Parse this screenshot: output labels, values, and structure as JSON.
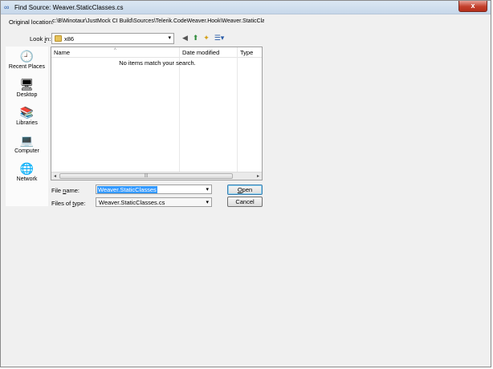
{
  "window": {
    "title": "Find Source: Weaver.StaticClasses.cs",
    "close_glyph": "x"
  },
  "original_location": {
    "label": "Original location:",
    "value": "c:\\B\\Minotaur\\JustMock CI Build\\Sources\\Telerik.CodeWeaver.Hook\\Weaver.StaticClasses.c"
  },
  "look_in": {
    "label_prefix": "Look ",
    "label_accel": "i",
    "label_suffix": "n:",
    "value": "x86"
  },
  "toolbar": {
    "back_glyph": "◀",
    "up_glyph": "⬆",
    "new_folder_glyph": "✦",
    "view_glyph": "☰▾"
  },
  "sidebar": {
    "items": [
      {
        "label": "Recent Places",
        "icon": "recent-places-icon",
        "glyph": "🕘"
      },
      {
        "label": "Desktop",
        "icon": "desktop-icon",
        "glyph": "🖥"
      },
      {
        "label": "Libraries",
        "icon": "libraries-icon",
        "glyph": "📚"
      },
      {
        "label": "Computer",
        "icon": "computer-icon",
        "glyph": "💻"
      },
      {
        "label": "Network",
        "icon": "network-icon",
        "glyph": "🌐"
      }
    ]
  },
  "file_list": {
    "columns": [
      "Name",
      "Date modified",
      "Type"
    ],
    "empty_message": "No items match your search.",
    "scroll_left": "◂",
    "scroll_right": "▸",
    "thumb_grip": "|||"
  },
  "file_name": {
    "label_prefix": "File ",
    "label_accel": "n",
    "label_suffix": "ame:",
    "value": "Weaver.StaticClasses"
  },
  "files_of_type": {
    "label_prefix": "Files of ",
    "label_accel": "t",
    "label_suffix": "ype:",
    "value": "Weaver.StaticClasses.cs"
  },
  "buttons": {
    "open_accel": "O",
    "open_rest": "pen",
    "cancel": "Cancel"
  },
  "combo_arrow": "▾",
  "sort_glyph": "^"
}
